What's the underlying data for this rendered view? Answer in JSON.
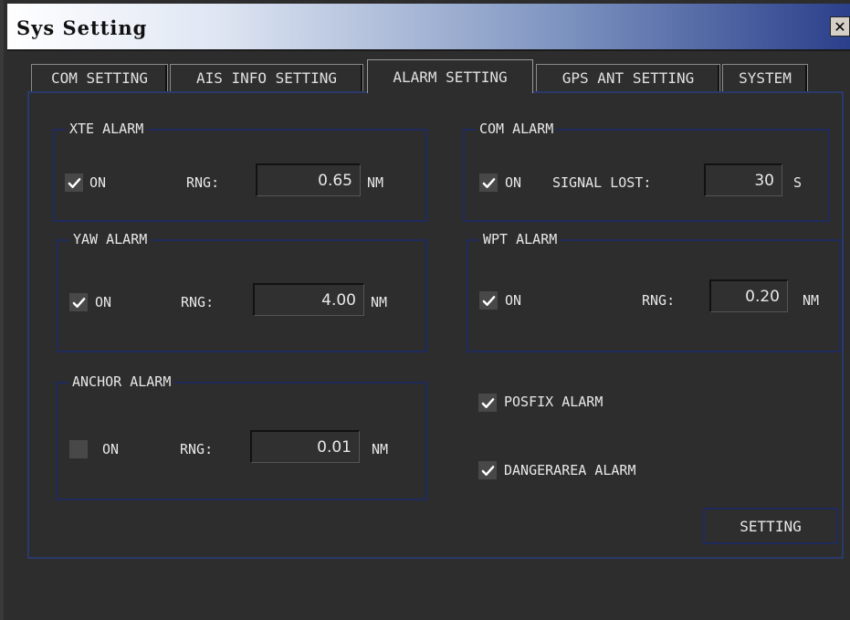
{
  "window": {
    "title": "Sys Setting",
    "close_icon": "close-icon"
  },
  "tabs": [
    {
      "label": "COM SETTING"
    },
    {
      "label": "AIS INFO SETTING"
    },
    {
      "label": "ALARM SETTING"
    },
    {
      "label": "GPS ANT SETTING"
    },
    {
      "label": "SYSTEM"
    }
  ],
  "active_tab": "ALARM SETTING",
  "xte_alarm": {
    "title": "XTE ALARM",
    "on_checked": true,
    "on_label": "ON",
    "rng_label": "RNG:",
    "rng_value": "0.65",
    "unit": "NM"
  },
  "com_alarm": {
    "title": "COM ALARM",
    "on_checked": true,
    "on_label": "ON",
    "signal_label": "SIGNAL LOST:",
    "signal_value": "30",
    "unit": "S"
  },
  "yaw_alarm": {
    "title": "YAW ALARM",
    "on_checked": true,
    "on_label": "ON",
    "rng_label": "RNG:",
    "rng_value": "4.00",
    "unit": "NM"
  },
  "wpt_alarm": {
    "title": "WPT ALARM",
    "on_checked": true,
    "on_label": "ON",
    "rng_label": "RNG:",
    "rng_value": "0.20",
    "unit": "NM"
  },
  "anchor_alarm": {
    "title": "ANCHOR ALARM",
    "on_checked": false,
    "on_label": "ON",
    "rng_label": "RNG:",
    "rng_value": "0.01",
    "unit": "NM"
  },
  "posfix_alarm": {
    "label": "POSFIX ALARM",
    "checked": true
  },
  "dangerarea_alarm": {
    "label": "DANGERAREA ALARM",
    "checked": true
  },
  "setting_button": {
    "label": "SETTING"
  },
  "colors": {
    "background": "#2d2d2d",
    "group_border": "#1f2a5c",
    "title_gradient_end": "#2a3f8a"
  }
}
